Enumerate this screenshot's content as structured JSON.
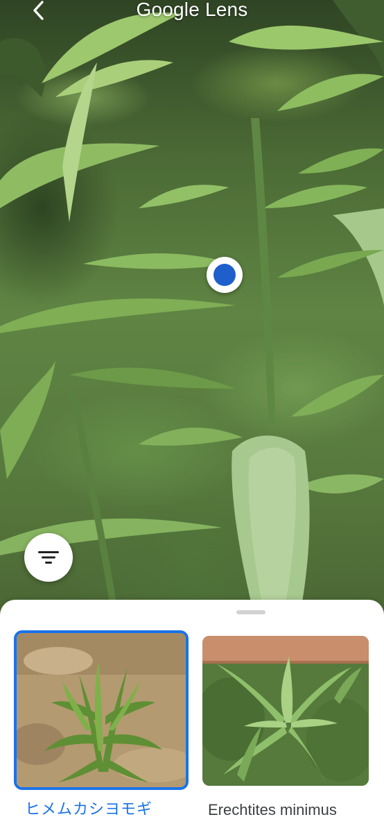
{
  "app": {
    "title": "Google Lens"
  },
  "top_bar": {
    "back_icon": "chevron-left-icon"
  },
  "camera": {
    "focus_marker_icon": "focus-dot-icon",
    "filter_icon": "filter-list-icon"
  },
  "results": {
    "items": [
      {
        "label": "ヒメムカシヨモギ",
        "selected": true
      },
      {
        "label": "Erechtites minimus",
        "selected": false
      }
    ]
  },
  "colors": {
    "accent": "#1a73e8",
    "focus_dot": "#1f5fcc",
    "sheet_background": "#ffffff",
    "label_text": "#3c4043"
  }
}
